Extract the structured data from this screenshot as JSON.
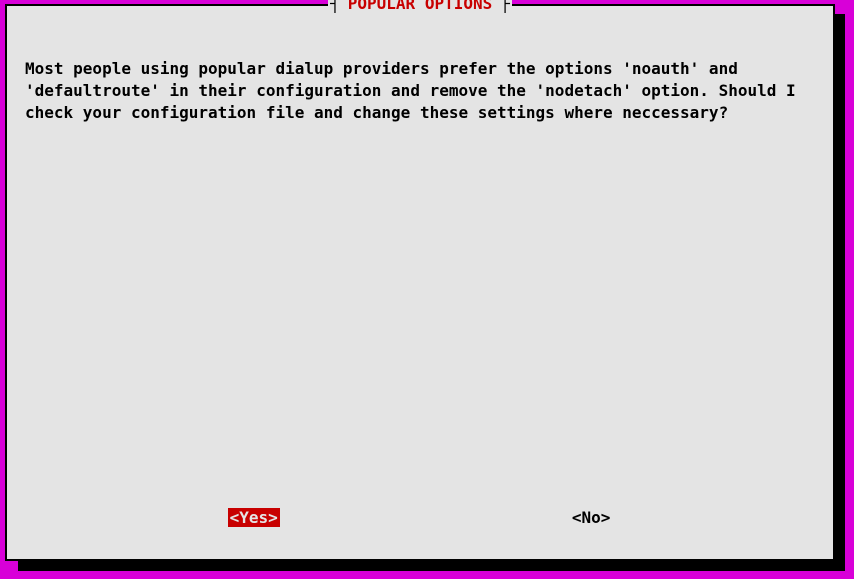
{
  "dialog": {
    "title": "POPULAR OPTIONS",
    "message": "Most people using popular dialup providers prefer the options 'noauth' and 'defaultroute' in their configuration and remove the 'nodetach' option. Should I check your configuration file and change these settings where neccessary?",
    "buttons": {
      "yes": "<Yes>",
      "no": "<No>"
    }
  },
  "colors": {
    "background": "#d800d8",
    "panel": "#e4e4e4",
    "accent": "#c80000",
    "text": "#000000"
  }
}
